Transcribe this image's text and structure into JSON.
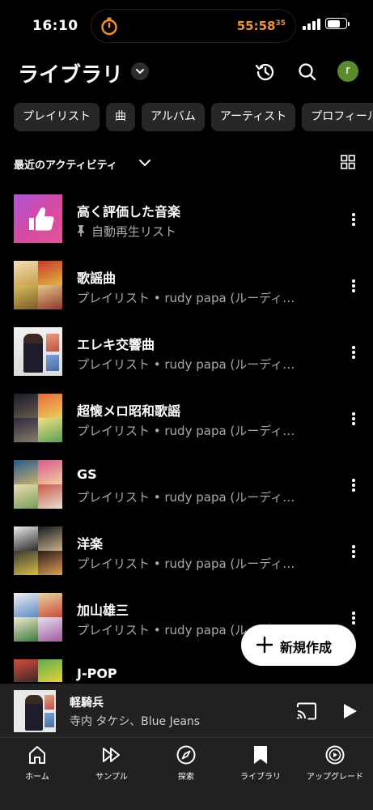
{
  "status_bar": {
    "time": "16:10",
    "timer_main": "55:58",
    "timer_small": "35",
    "accent_color": "#f0952b"
  },
  "header": {
    "title": "ライブラリ",
    "avatar_letter": "r",
    "icons": [
      "history-icon",
      "search-icon"
    ]
  },
  "filters": [
    "プレイリスト",
    "曲",
    "アルバム",
    "アーティスト",
    "プロフィール"
  ],
  "sort": {
    "label": "最近のアクティビティ"
  },
  "items": [
    {
      "title": "高く評価した音楽",
      "subtitle": "自動再生リスト",
      "pinned": true
    },
    {
      "title": "歌謡曲",
      "subtitle": "プレイリスト • rudy papa (ルーディ…"
    },
    {
      "title": "エレキ交響曲",
      "subtitle": "プレイリスト • rudy papa (ルーディ…"
    },
    {
      "title": "超懐メロ昭和歌謡",
      "subtitle": "プレイリスト • rudy papa (ルーディ…"
    },
    {
      "title": "GS",
      "subtitle": "プレイリスト • rudy papa (ルーディ…"
    },
    {
      "title": "洋楽",
      "subtitle": "プレイリスト • rudy papa (ルーディ…"
    },
    {
      "title": "加山雄三",
      "subtitle": "プレイリスト • rudy papa (ルーディ…"
    },
    {
      "title": "J-POP",
      "subtitle": ""
    }
  ],
  "fab": {
    "label": "新規作成"
  },
  "now_playing": {
    "title": "軽騎兵",
    "artist": "寺内 タケシ、Blue Jeans"
  },
  "nav": [
    {
      "label": "ホーム",
      "icon": "home-icon"
    },
    {
      "label": "サンプル",
      "icon": "samples-icon"
    },
    {
      "label": "探索",
      "icon": "explore-icon"
    },
    {
      "label": "ライブラリ",
      "icon": "library-icon"
    },
    {
      "label": "アップグレード",
      "icon": "upgrade-icon"
    }
  ]
}
